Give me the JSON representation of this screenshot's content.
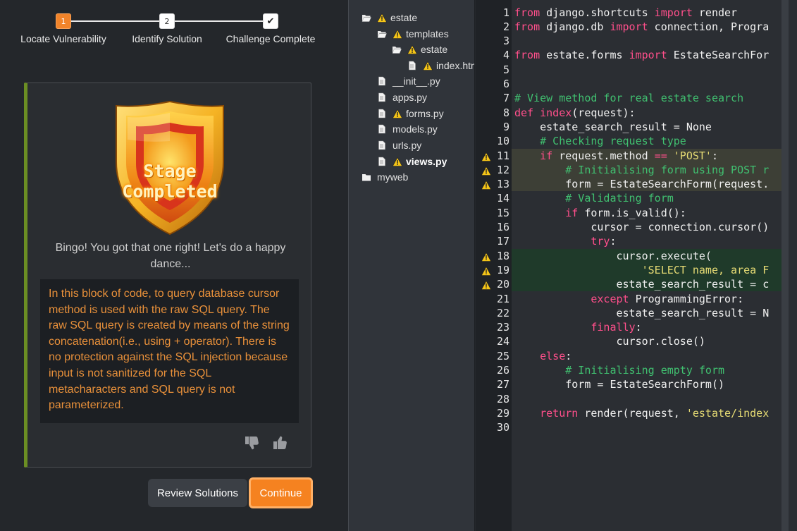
{
  "stepper": {
    "steps": [
      {
        "num": "1",
        "label": "Locate Vulnerability"
      },
      {
        "num": "2",
        "label": "Identify Solution"
      },
      {
        "num": "✔",
        "label": "Challenge Complete"
      }
    ]
  },
  "card": {
    "badge_text": "Stage Completed",
    "message": "Bingo! You got that one right! Let's do a happy dance...",
    "explanation": "In this block of code, to query database cursor method is used with the raw SQL query. The raw SQL query is created by means of the string concatenation(i.e., using + operator). There is no protection against the SQL injection because input is not sanitized for the SQL metacharacters and SQL query is not parameterized."
  },
  "buttons": {
    "review": "Review Solutions",
    "continue": "Continue"
  },
  "tree": {
    "items": [
      {
        "label": "estate",
        "type": "folder-open",
        "warn": true
      },
      {
        "label": "templates",
        "type": "folder-open",
        "warn": true
      },
      {
        "label": "estate",
        "type": "folder-open",
        "warn": true
      },
      {
        "label": "index.html",
        "type": "file",
        "warn": true
      },
      {
        "label": "__init__.py",
        "type": "file",
        "warn": false
      },
      {
        "label": "apps.py",
        "type": "file",
        "warn": false
      },
      {
        "label": "forms.py",
        "type": "file",
        "warn": true
      },
      {
        "label": "models.py",
        "type": "file",
        "warn": false
      },
      {
        "label": "urls.py",
        "type": "file",
        "warn": false
      },
      {
        "label": "views.py",
        "type": "file",
        "warn": true,
        "active": true
      },
      {
        "label": "myweb",
        "type": "folder",
        "warn": false
      }
    ]
  },
  "editor": {
    "lines": [
      "1",
      "2",
      "3",
      "4",
      "5",
      "6",
      "7",
      "8",
      "9",
      "10",
      "11",
      "12",
      "13",
      "14",
      "15",
      "16",
      "17",
      "18",
      "19",
      "20",
      "21",
      "22",
      "23",
      "24",
      "25",
      "26",
      "27",
      "28",
      "29",
      "30"
    ],
    "warn_lines": [
      11,
      12,
      13,
      18,
      19,
      20
    ],
    "code": [
      "from django.shortcuts import render",
      "from django.db import connection, Progra",
      "",
      "from estate.forms import EstateSearchFor",
      "",
      "",
      "# View method for real estate search",
      "def index(request):",
      "    estate_search_result = None",
      "    # Checking request type",
      "    if request.method == 'POST':",
      "        # Initialising form using POST r",
      "        form = EstateSearchForm(request.",
      "        # Validating form",
      "        if form.is_valid():",
      "            cursor = connection.cursor()",
      "            try:",
      "                cursor.execute(",
      "                    'SELECT name, area F",
      "                estate_search_result = c",
      "            except ProgrammingError:",
      "                estate_search_result = N",
      "            finally:",
      "                cursor.close()",
      "    else:",
      "        # Initialising empty form",
      "        form = EstateSearchForm()",
      "",
      "    return render(request, 'estate/index",
      ""
    ]
  }
}
